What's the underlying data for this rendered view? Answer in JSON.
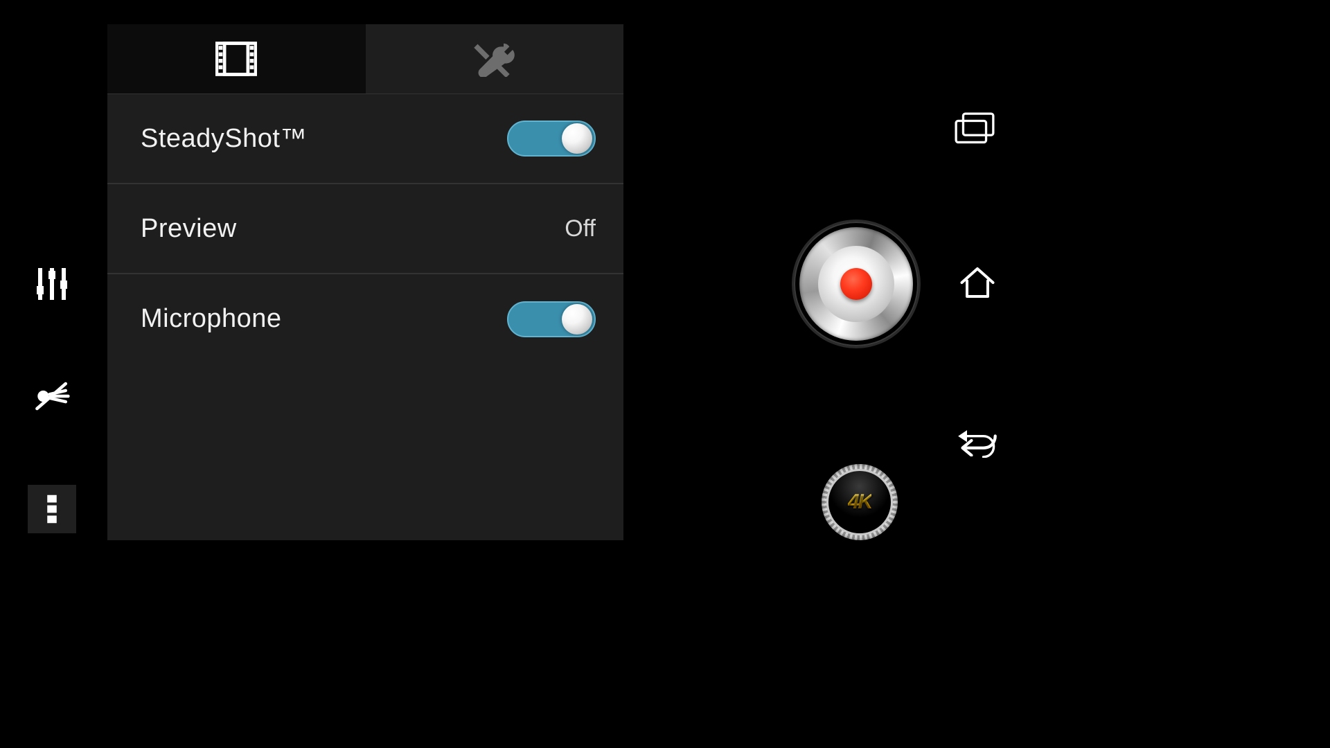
{
  "leftbar": {
    "sliders_name": "adjust-icon",
    "nolight_name": "flash-off-icon",
    "menu_name": "overflow-menu-icon"
  },
  "panel": {
    "tabs": {
      "video_name": "film-icon",
      "tools_name": "tools-icon"
    },
    "rows": {
      "steadyshot": {
        "label": "SteadyShot™",
        "state": "on"
      },
      "preview": {
        "label": "Preview",
        "value": "Off"
      },
      "microphone": {
        "label": "Microphone",
        "state": "on"
      }
    }
  },
  "right": {
    "gallery_name": "gallery-icon",
    "record_name": "record-button",
    "home_name": "home-icon",
    "back_name": "back-icon",
    "mode_label": "4K"
  }
}
